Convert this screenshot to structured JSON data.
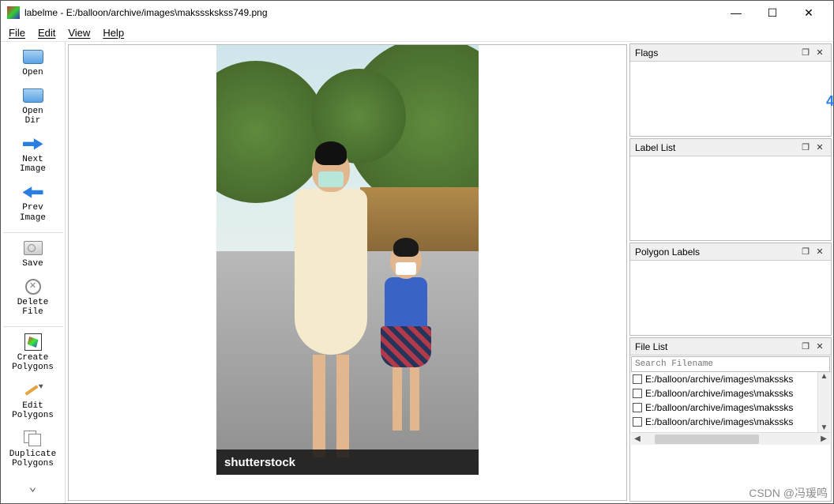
{
  "titlebar": {
    "app": "labelme",
    "sep": " - ",
    "path": "E:/balloon/archive/images\\makssskskss749.png"
  },
  "win": {
    "min": "—",
    "max": "☐",
    "close": "✕"
  },
  "menu": {
    "file": "File",
    "edit": "Edit",
    "view": "View",
    "help": "Help"
  },
  "tools": {
    "open": "Open",
    "open_dir": "Open\nDir",
    "next": "Next\nImage",
    "prev": "Prev\nImage",
    "save": "Save",
    "delete": "Delete\nFile",
    "create": "Create\nPolygons",
    "edit_poly": "Edit\nPolygons",
    "dup": "Duplicate\nPolygons"
  },
  "panels": {
    "flags": "Flags",
    "label_list": "Label List",
    "polygon_labels": "Polygon Labels",
    "file_list": "File List",
    "restore": "❐",
    "close": "✕"
  },
  "search": {
    "placeholder": "Search Filename"
  },
  "files": [
    "E:/balloon/archive/images\\makssks",
    "E:/balloon/archive/images\\makssks",
    "E:/balloon/archive/images\\makssks",
    "E:/balloon/archive/images\\makssks"
  ],
  "watermark_bar": "shutterstock",
  "footer_watermark": "CSDN @冯瑗鸣",
  "stray_char": "4"
}
